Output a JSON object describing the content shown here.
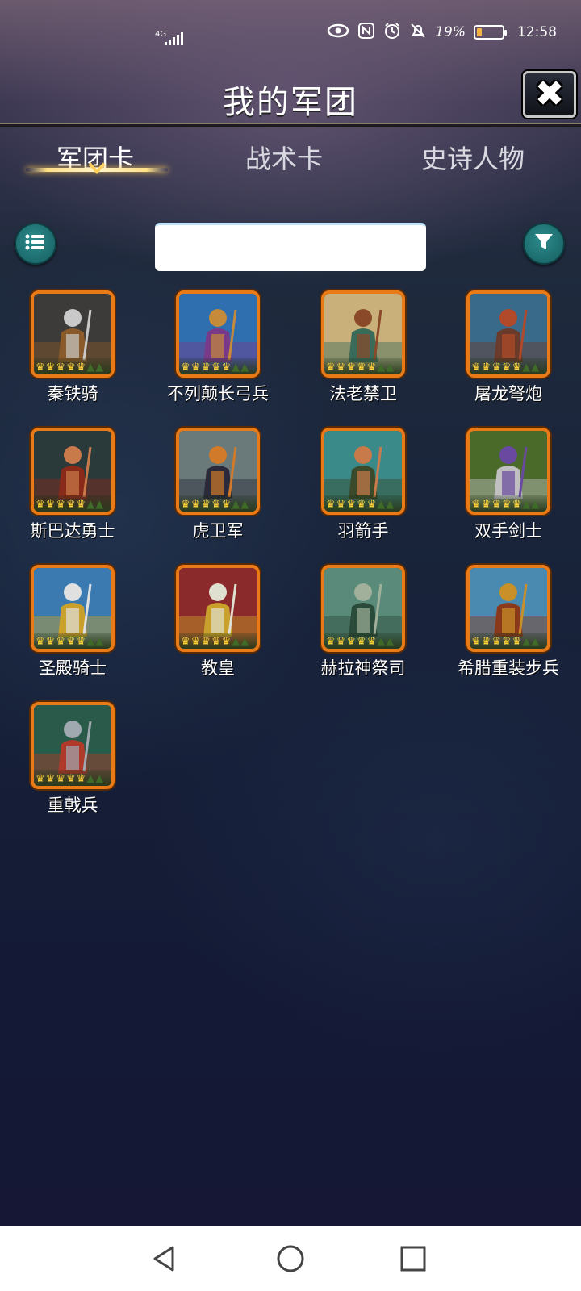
{
  "status_bar": {
    "network": "4G",
    "battery_percent": "19%",
    "battery_level": 0.19,
    "time": "12:58",
    "icons": [
      "eye-icon",
      "nfc-icon",
      "alarm-icon",
      "mute-icon"
    ]
  },
  "header": {
    "title": "我的军团",
    "close_icon": "close-icon"
  },
  "tabs": [
    {
      "label": "军团卡",
      "active": true
    },
    {
      "label": "战术卡",
      "active": false
    },
    {
      "label": "史诗人物",
      "active": false
    }
  ],
  "search": {
    "value": "",
    "placeholder": ""
  },
  "toolbar": {
    "list_icon": "list-icon",
    "filter_icon": "filter-icon"
  },
  "cards": [
    {
      "name": "秦铁骑",
      "art": "cavalry-icon",
      "colors": [
        "#3d3a3a",
        "#c9c9c9",
        "#8a5a2a"
      ]
    },
    {
      "name": "不列颠长弓兵",
      "art": "archer-icon",
      "colors": [
        "#2f6fb0",
        "#c58a3a",
        "#7a3a8a"
      ]
    },
    {
      "name": "法老禁卫",
      "art": "pharaoh-guard-icon",
      "colors": [
        "#c9b07a",
        "#8a4a2a",
        "#3a6a5a"
      ]
    },
    {
      "name": "屠龙弩炮",
      "art": "dragon-icon",
      "colors": [
        "#3a6a8a",
        "#b04a2a",
        "#6a3a2a"
      ]
    },
    {
      "name": "斯巴达勇士",
      "art": "spartan-icon",
      "colors": [
        "#2a3a3a",
        "#c97a4a",
        "#8a2a1a"
      ]
    },
    {
      "name": "虎卫军",
      "art": "tiger-icon",
      "colors": [
        "#6a7a7a",
        "#d07a2a",
        "#2a2a3a"
      ]
    },
    {
      "name": "羽箭手",
      "art": "feather-archer-icon",
      "colors": [
        "#3a8a8a",
        "#c97a4a",
        "#3a4a2a"
      ]
    },
    {
      "name": "双手剑士",
      "art": "swordsman-icon",
      "colors": [
        "#4a6a2a",
        "#6a4aa0",
        "#c0c0c0"
      ]
    },
    {
      "name": "圣殿骑士",
      "art": "templar-icon",
      "colors": [
        "#3a7ab0",
        "#e0e0e0",
        "#c9a02a"
      ]
    },
    {
      "name": "教皇",
      "art": "pope-icon",
      "colors": [
        "#8a2a2a",
        "#e0e0d0",
        "#c9a02a"
      ]
    },
    {
      "name": "赫拉神祭司",
      "art": "priestess-icon",
      "colors": [
        "#5a8a7a",
        "#a0b09a",
        "#2a4a3a"
      ]
    },
    {
      "name": "希腊重装步兵",
      "art": "hoplite-icon",
      "colors": [
        "#4a8ab0",
        "#c9902a",
        "#8a3a1a"
      ]
    },
    {
      "name": "重戟兵",
      "art": "halberdier-icon",
      "colors": [
        "#2a5a4a",
        "#a0a8b0",
        "#b03a2a"
      ]
    }
  ],
  "nav": {
    "back_icon": "back-icon",
    "home_icon": "home-icon",
    "recents_icon": "recents-icon"
  }
}
